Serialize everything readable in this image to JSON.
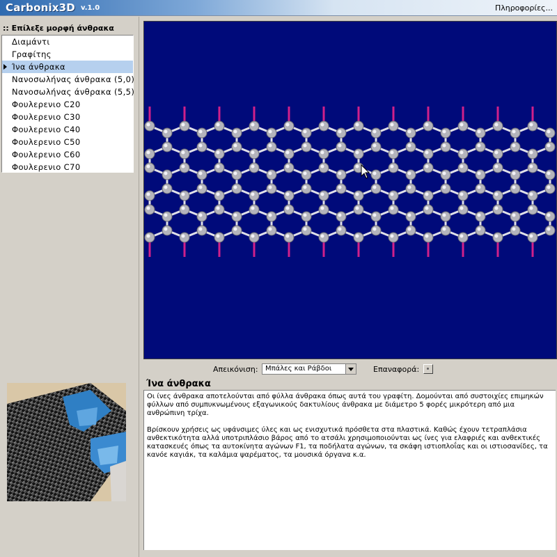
{
  "app": {
    "title": "Carbonix3D",
    "version": "v.1.0",
    "info_link": "Πληροφορίες..."
  },
  "sidebar": {
    "header": ":: Επίλεξε μορφή άνθρακα",
    "items": [
      {
        "label": "Διαμάντι",
        "selected": false
      },
      {
        "label": "Γραφίτης",
        "selected": false
      },
      {
        "label": "Ίνα άνθρακα",
        "selected": true
      },
      {
        "label": "Νανοσωλήνας άνθρακα (5,0)",
        "selected": false
      },
      {
        "label": "Νανοσωλήνας άνθρακα (5,5)",
        "selected": false
      },
      {
        "label": "Φουλερενιο C20",
        "selected": false
      },
      {
        "label": "Φουλερενιο C30",
        "selected": false
      },
      {
        "label": "Φουλερενιο C40",
        "selected": false
      },
      {
        "label": "Φουλερενιο C50",
        "selected": false
      },
      {
        "label": "Φουλερενιο C60",
        "selected": false
      },
      {
        "label": "Φουλερενιο C70",
        "selected": false
      }
    ]
  },
  "viewer": {
    "background": "#000a7a",
    "atom_color": "#b4b4bc",
    "bond_color": "#e0e0e8",
    "hydrogen_color": "#d0208a"
  },
  "toolbar": {
    "display_label": "Απεικόνιση:",
    "display_value": "Μπάλες και Ράβδοι",
    "reset_label": "Επαναφορά:"
  },
  "description": {
    "title": "Ίνα άνθρακα",
    "paragraphs": [
      "Οι ίνες άνθρακα αποτελούνται από φύλλα άνθρακα όπως αυτά του γραφίτη.  Δομούνται από συστοιχίες επιμηκών φύλλων από συμπυκνωμένους εξαγωνικούς δακτυλίους άνθρακα με διάμετρο 5 φορές μικρότερη από μια ανθρώπινη τρίχα.",
      "Βρίσκουν χρήσεις ως υφάνσιμες ύλες και ως ενισχυτικά πρόσθετα στα πλαστικά. Καθώς έχουν τετραπλάσια ανθεκτικότητα αλλά υποτριπλάσιο βάρος από το ατσάλι χρησιμοποιούνται ως ίνες για ελαφριές και ανθεκτικές κατασκευές όπως τα αυτοκίνητα αγώνων F1, τα ποδήλατα αγώνων, τα σκάφη ιστιοπλοΐας και οι ιστιοσανίδες, τα κανόε καγιάκ, τα καλάμια ψαρέματος, τα μουσικά όργανα κ.α."
    ]
  }
}
